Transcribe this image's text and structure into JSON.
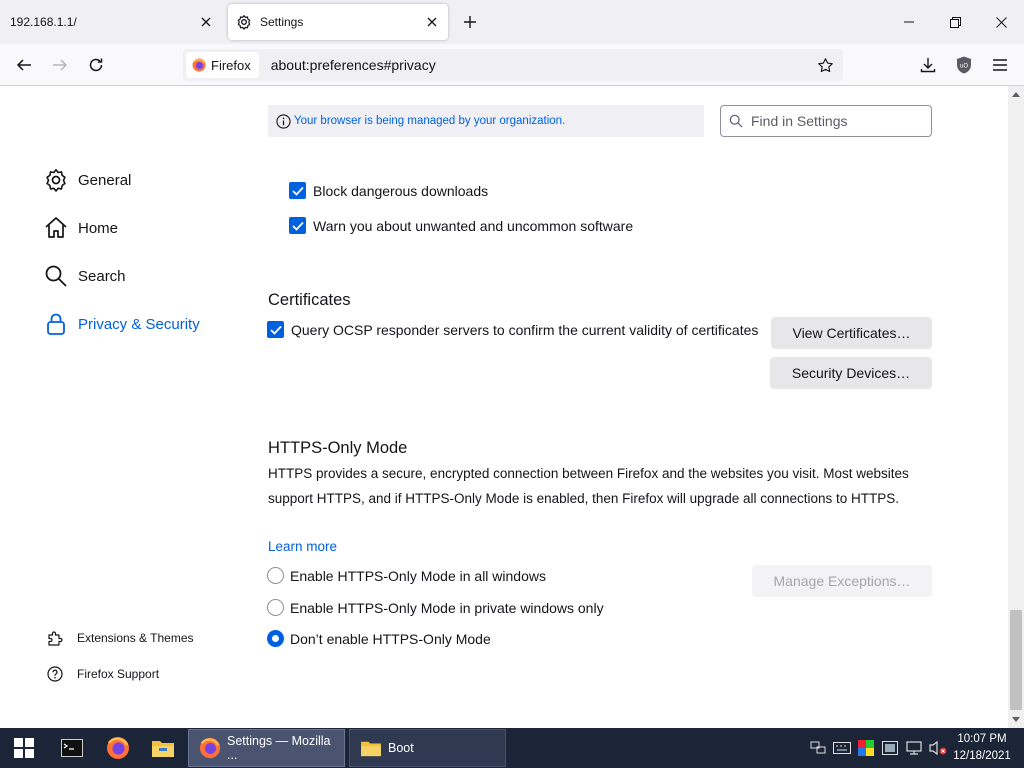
{
  "tabs": [
    {
      "title": "192.168.1.1/"
    },
    {
      "title": "Settings"
    }
  ],
  "navbar": {
    "identity_label": "Firefox",
    "url": "about:preferences#privacy"
  },
  "sidebar": {
    "categories": [
      {
        "label": "General",
        "icon": "gear-icon"
      },
      {
        "label": "Home",
        "icon": "home-icon"
      },
      {
        "label": "Search",
        "icon": "search-icon"
      },
      {
        "label": "Privacy & Security",
        "icon": "lock-icon",
        "selected": true
      }
    ],
    "footer": [
      {
        "label": "Extensions & Themes",
        "icon": "puzzle-icon"
      },
      {
        "label": "Firefox Support",
        "icon": "help-icon"
      }
    ]
  },
  "policy_banner": "Your browser is being managed by your organization.",
  "find_placeholder": "Find in Settings",
  "security": {
    "block_dangerous": {
      "label": "Block dangerous downloads",
      "checked": true
    },
    "warn_unwanted": {
      "label": "Warn you about unwanted and uncommon software",
      "checked": true
    }
  },
  "certificates": {
    "heading": "Certificates",
    "ocsp": {
      "label": "Query OCSP responder servers to confirm the current validity of certificates",
      "checked": true
    },
    "view_button": "View Certificates…",
    "devices_button": "Security Devices…"
  },
  "https_only": {
    "heading": "HTTPS-Only Mode",
    "description": "HTTPS provides a secure, encrypted connection between Firefox and the websites you visit. Most websites support HTTPS, and if HTTPS-Only Mode is enabled, then Firefox will upgrade all connections to HTTPS.",
    "learn_more": "Learn more",
    "options": [
      {
        "label": "Enable HTTPS-Only Mode in all windows",
        "selected": false
      },
      {
        "label": "Enable HTTPS-Only Mode in private windows only",
        "selected": false
      },
      {
        "label": "Don’t enable HTTPS-Only Mode",
        "selected": true
      }
    ],
    "manage_exceptions": "Manage Exceptions…"
  },
  "taskbar": {
    "windows": [
      {
        "label": "Settings — Mozilla ...",
        "icon": "firefox-icon",
        "active": true
      },
      {
        "label": "Boot",
        "icon": "folder-icon",
        "active": false
      }
    ],
    "clock_time": "10:07 PM",
    "clock_date": "12/18/2021"
  },
  "colors": {
    "accent": "#0061e0",
    "taskbar": "#1c2437"
  }
}
